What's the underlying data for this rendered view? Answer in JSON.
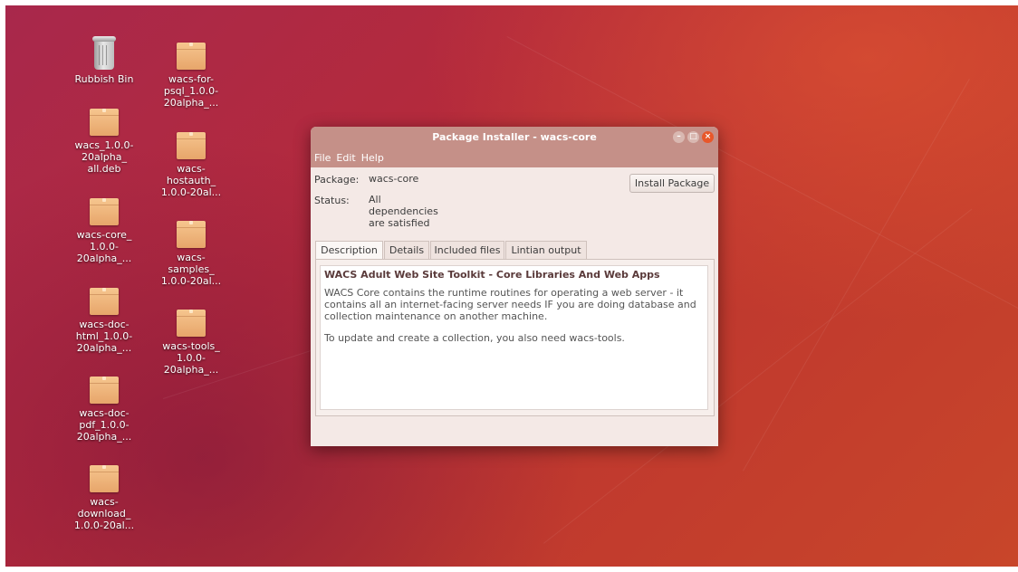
{
  "desktop": {
    "icons": [
      {
        "label": "Rubbish Bin",
        "type": "trash"
      },
      {
        "label": "wacs_1.0.0-\n20alpha_\nall.deb",
        "type": "package"
      },
      {
        "label": "wacs-core_\n1.0.0-\n20alpha_...",
        "type": "package"
      },
      {
        "label": "wacs-doc-\nhtml_1.0.0-\n20alpha_...",
        "type": "package"
      },
      {
        "label": "wacs-doc-\npdf_1.0.0-\n20alpha_...",
        "type": "package"
      },
      {
        "label": "wacs-\ndownload_\n1.0.0-20al...",
        "type": "package"
      },
      {
        "label": "wacs-for-\npsql_1.0.0-\n20alpha_...",
        "type": "package"
      },
      {
        "label": "wacs-\nhostauth_\n1.0.0-20al...",
        "type": "package"
      },
      {
        "label": "wacs-\nsamples_\n1.0.0-20al...",
        "type": "package"
      },
      {
        "label": "wacs-tools_\n1.0.0-\n20alpha_...",
        "type": "package"
      }
    ]
  },
  "window": {
    "title": "Package Installer - wacs-core",
    "menu": [
      "File",
      "Edit",
      "Help"
    ],
    "package_label": "Package:",
    "package_value": "wacs-core",
    "status_label": "Status:",
    "status_lines": [
      "All",
      "dependencies",
      "are satisfied"
    ],
    "install_button": "Install Package",
    "tabs": [
      "Description",
      "Details",
      "Included files",
      "Lintian output"
    ],
    "active_tab": "Description",
    "description": {
      "title": "WACS Adult Web Site Toolkit - Core Libraries And Web Apps",
      "paragraph1_lines": [
        "WACS Core contains the runtime routines for operating a web server - it",
        "contains all an internet-facing server needs IF you are doing database and",
        "collection maintenance on another machine."
      ],
      "paragraph2": "To update and create a collection, you also need wacs-tools."
    },
    "controls": {
      "minimize_icon": "minimize-icon",
      "maximize_icon": "maximize-icon",
      "close_icon": "close-icon",
      "close_color": "#e8572a"
    }
  }
}
